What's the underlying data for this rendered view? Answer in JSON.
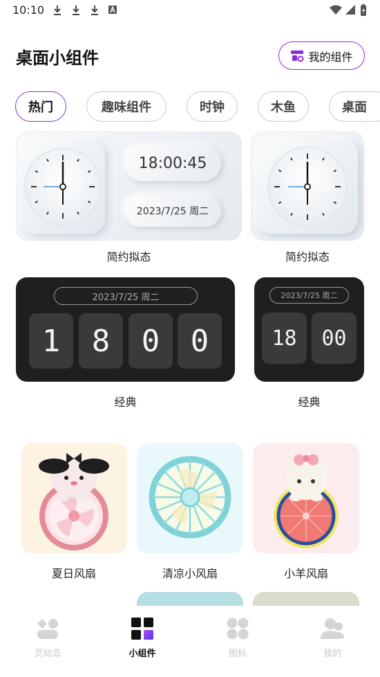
{
  "status_bar": {
    "time": "10:10",
    "icons": [
      "download-icon",
      "download-icon",
      "download-icon",
      "a-icon",
      "wifi-icon",
      "signal-icon",
      "battery-icon"
    ]
  },
  "header": {
    "title": "桌面小组件",
    "my_widgets_label": "我的组件"
  },
  "tabs": [
    {
      "label": "热门",
      "active": true
    },
    {
      "label": "趣味组件",
      "active": false
    },
    {
      "label": "时钟",
      "active": false
    },
    {
      "label": "木鱼",
      "active": false
    },
    {
      "label": "桌面",
      "active": false
    }
  ],
  "widgets": {
    "simple_large": {
      "time": "18:00:45",
      "date": "2023/7/25 周二",
      "caption": "简约拟态"
    },
    "simple_small": {
      "caption": "简约拟态"
    },
    "classic_large": {
      "date": "2023/7/25 周二",
      "digits": [
        "1",
        "8",
        "0",
        "0"
      ],
      "caption": "经典"
    },
    "classic_small": {
      "date": "2023/7/25 周二",
      "digits": [
        "18",
        "00"
      ],
      "caption": "经典"
    }
  },
  "fans": [
    {
      "caption": "夏日风扇",
      "bg": "#fdf3e2"
    },
    {
      "caption": "清凉小风扇",
      "bg": "#e9f8fb"
    },
    {
      "caption": "小羊风扇",
      "bg": "#fdecee"
    }
  ],
  "bottom_nav": [
    {
      "label": "灵动岛",
      "icon": "dynamic-island-icon",
      "active": false
    },
    {
      "label": "小组件",
      "icon": "widgets-grid-icon",
      "active": true
    },
    {
      "label": "图标",
      "icon": "icons-icon",
      "active": false
    },
    {
      "label": "我的",
      "icon": "profile-icon",
      "active": false
    }
  ],
  "colors": {
    "accent": "#8a2be2",
    "inactive": "#c8c8c8",
    "dark_card": "#1f1f1f"
  }
}
